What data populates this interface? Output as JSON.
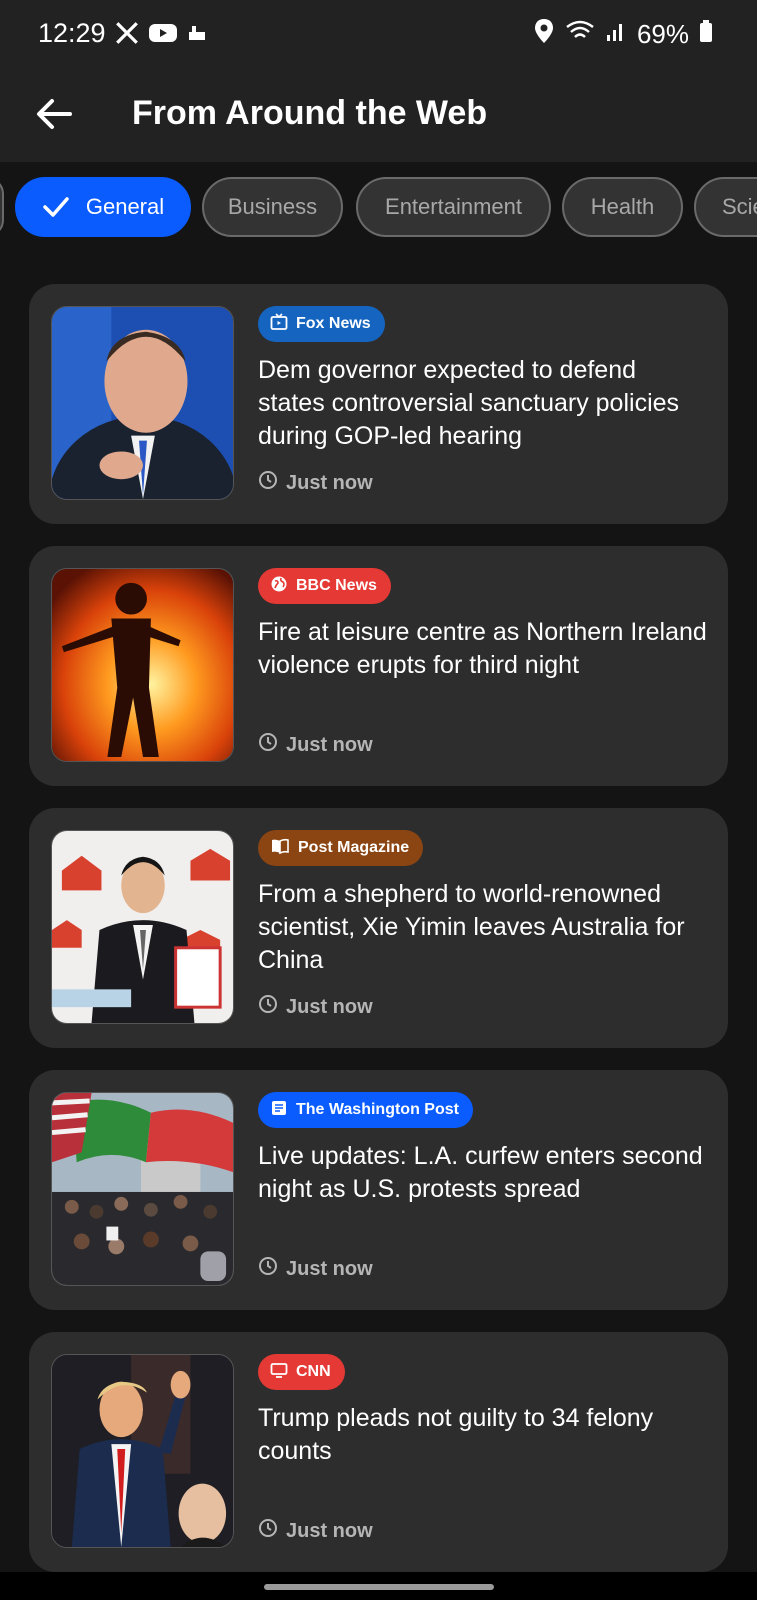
{
  "status_bar": {
    "time": "12:29",
    "battery": "69%"
  },
  "header": {
    "title": "From Around the Web"
  },
  "categories": [
    {
      "label": "General",
      "selected": true
    },
    {
      "label": "Business",
      "selected": false
    },
    {
      "label": "Entertainment",
      "selected": false
    },
    {
      "label": "Health",
      "selected": false
    },
    {
      "label": "Scie",
      "selected": false
    }
  ],
  "articles": [
    {
      "source": "Fox News",
      "source_color": "#1565c0",
      "icon": "tv-icon",
      "headline": "Dem governor expected to defend states controversial sanctuary policies during GOP-led hearing",
      "time": "Just now"
    },
    {
      "source": "BBC News",
      "source_color": "#e53935",
      "icon": "globe-icon",
      "headline": "Fire at leisure centre as Northern Ireland violence erupts for third night",
      "time": "Just now"
    },
    {
      "source": "Post Magazine",
      "source_color": "#8b4513",
      "icon": "book-icon",
      "headline": "From a shepherd to world-renowned scientist, Xie Yimin leaves Australia for China",
      "time": "Just now"
    },
    {
      "source": "The Washington Post",
      "source_color": "#0a5cff",
      "icon": "article-icon",
      "headline": "Live updates: L.A. curfew enters second night as U.S. protests spread",
      "time": "Just now"
    },
    {
      "source": "CNN",
      "source_color": "#e53935",
      "icon": "monitor-icon",
      "headline": "Trump pleads not guilty to 34 felony counts",
      "time": "Just now"
    }
  ]
}
